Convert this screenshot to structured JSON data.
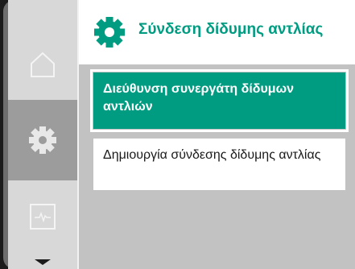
{
  "header": {
    "title": "Σύνδεση δίδυμης αντλίας",
    "icon": "settings-gear-icon",
    "accent": "#009c82"
  },
  "sidebar": {
    "items": [
      {
        "name": "home",
        "icon": "home-icon",
        "active": false
      },
      {
        "name": "settings",
        "icon": "gear-icon",
        "active": true
      },
      {
        "name": "monitor",
        "icon": "pulse-monitor-icon",
        "active": false
      }
    ],
    "scroll_icon": "chevron-down-icon"
  },
  "menu": {
    "items": [
      {
        "label": "Διεύθυνση συνεργάτη δίδυμων αντλιών",
        "selected": true
      },
      {
        "label": "Δημιουργία σύνδεσης δίδυμης αντλίας",
        "selected": false
      }
    ]
  }
}
